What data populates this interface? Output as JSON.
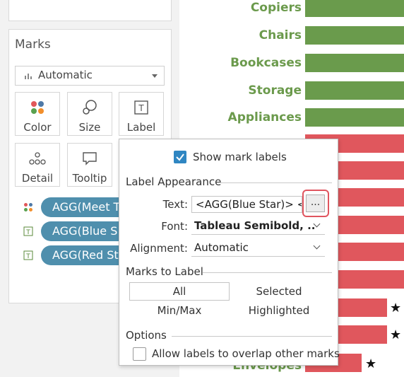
{
  "marks_panel": {
    "title": "Marks",
    "mark_type": {
      "value": "Automatic"
    },
    "buttons": [
      {
        "label": "Color",
        "icon": "color-dots-icon"
      },
      {
        "label": "Size",
        "icon": "size-icon"
      },
      {
        "label": "Label",
        "icon": "label-text-icon"
      },
      {
        "label": "Detail",
        "icon": "detail-dots-icon"
      },
      {
        "label": "Tooltip",
        "icon": "tooltip-icon"
      }
    ],
    "pills": [
      {
        "text": "AGG(Meet T",
        "icon": "color-dots-icon"
      },
      {
        "text": "AGG(Blue S",
        "icon": "text-field-icon"
      },
      {
        "text": "AGG(Red St",
        "icon": "text-field-icon"
      }
    ]
  },
  "chart": {
    "categories": [
      "Copiers",
      "Chairs",
      "Bookcases",
      "Storage",
      "Appliances",
      "Envelopes"
    ],
    "colors": {
      "green": "#6a9b4c",
      "red": "#e0575d"
    },
    "star_glyph": "★"
  },
  "label_popup": {
    "show_mark_labels": "Show mark labels",
    "label_appearance": "Label Appearance",
    "text_label": "Text:",
    "text_value": "<AGG(Blue Star)> <AGG(R",
    "ellipsis": "...",
    "font_label": "Font:",
    "font_value": "Tableau Semibold, ..",
    "alignment_label": "Alignment:",
    "alignment_value": "Automatic",
    "marks_to_label": "Marks to Label",
    "opt_all": "All",
    "opt_selected": "Selected",
    "opt_minmax": "Min/Max",
    "opt_highlighted": "Highlighted",
    "options": "Options",
    "allow_overlap": "Allow labels to overlap other marks"
  }
}
